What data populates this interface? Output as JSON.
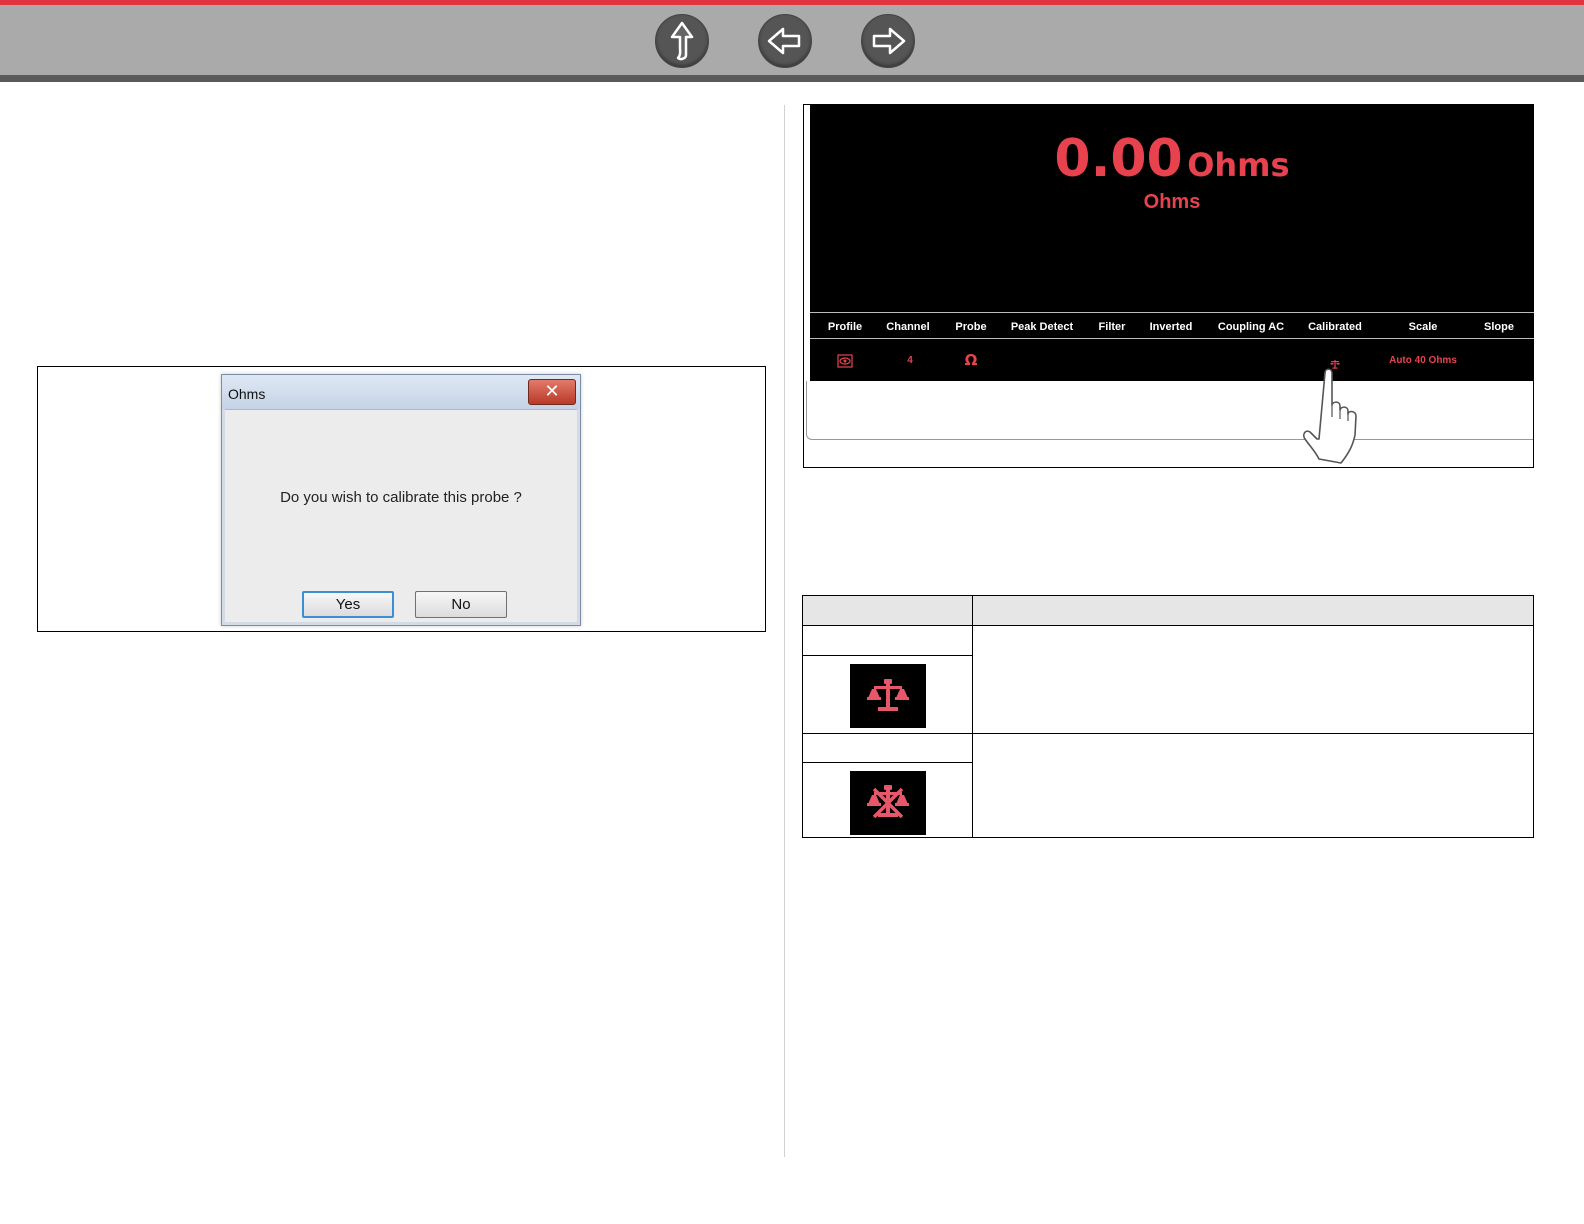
{
  "nav": {
    "up_icon": "up-arrow-icon",
    "back_icon": "left-arrow-icon",
    "forward_icon": "right-arrow-icon"
  },
  "dialog": {
    "title": "Ohms",
    "close_glyph": "✕",
    "message": "Do you wish to calibrate this probe ?",
    "yes_label": "Yes",
    "no_label": "No"
  },
  "meter": {
    "reading_value": "0.00",
    "reading_unit": "Ohms",
    "sublabel": "Ohms",
    "headers": {
      "profile": "Profile",
      "channel": "Channel",
      "probe": "Probe",
      "peak_detect": "Peak Detect",
      "filter": "Filter",
      "inverted": "Inverted",
      "coupling": "Coupling AC",
      "calibrated": "Calibrated",
      "scale": "Scale",
      "slope": "Slope"
    },
    "values": {
      "profile_icon": "eye-icon",
      "channel": "4",
      "probe_glyph": "Ω",
      "calibrated_icon": "scale-balance-icon",
      "scale": "Auto 40 Ohms"
    },
    "accent_color": "#e8424f"
  },
  "table": {
    "row1_icon": "calibrated-balance-icon",
    "row2_icon": "not-calibrated-balance-icon"
  }
}
